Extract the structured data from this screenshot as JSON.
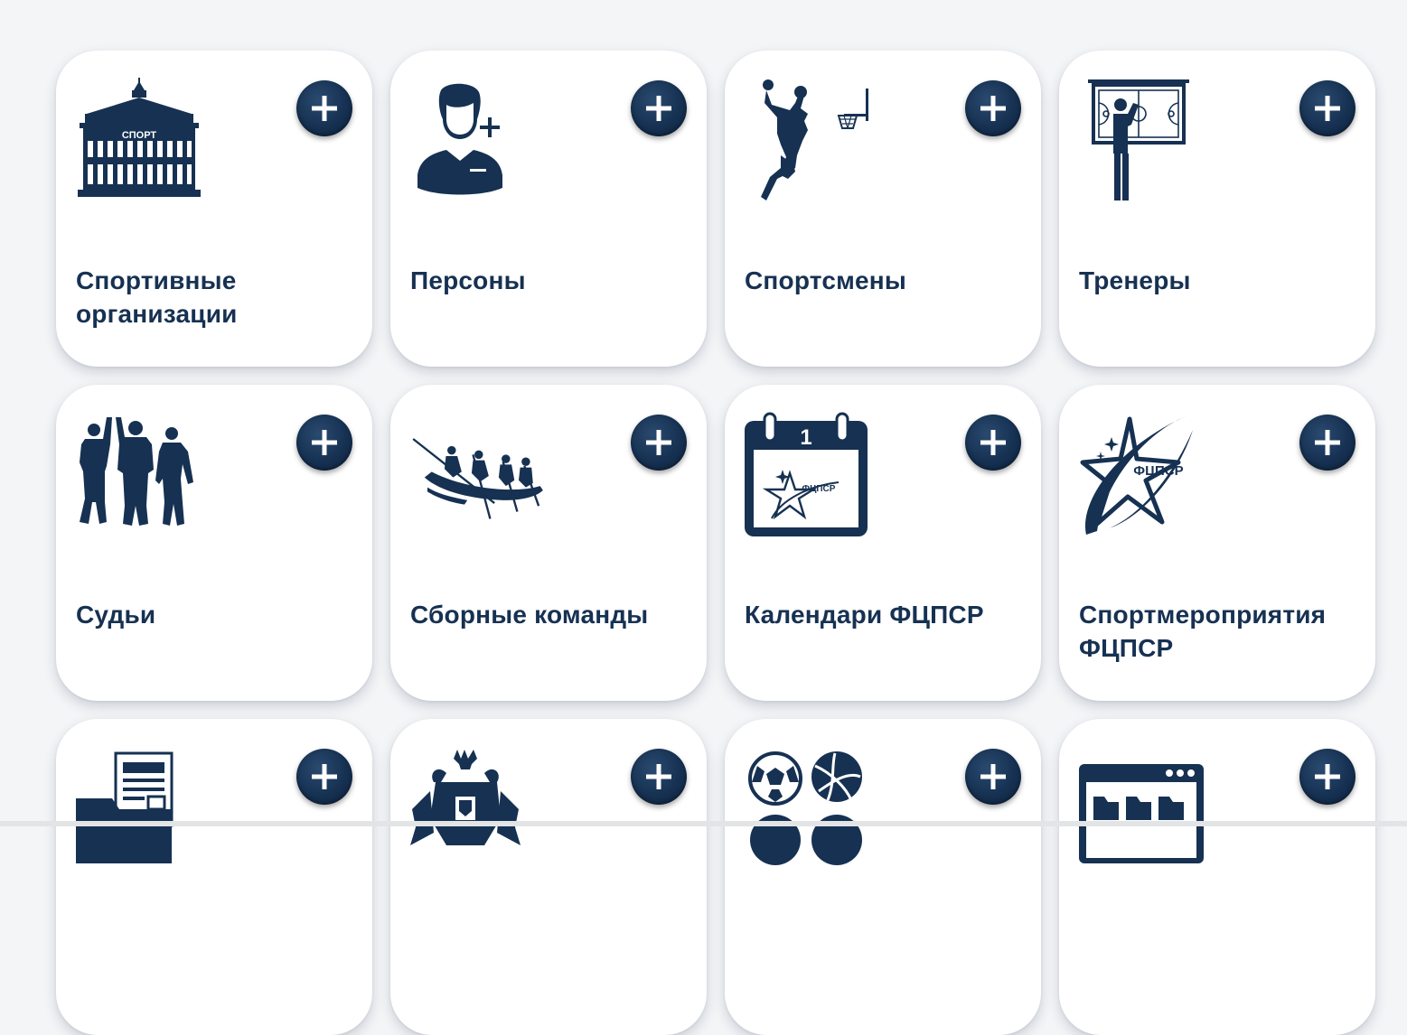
{
  "colors": {
    "primary": "#163152",
    "background": "#f4f5f7",
    "card": "#ffffff"
  },
  "cards": [
    {
      "title": "Спортивные организации",
      "icon": "sport-building-icon",
      "icon_text": "СПОРТ"
    },
    {
      "title": "Персоны",
      "icon": "person-add-icon"
    },
    {
      "title": "Спортсмены",
      "icon": "basketball-player-icon"
    },
    {
      "title": "Тренеры",
      "icon": "coach-board-icon"
    },
    {
      "title": "Судьи",
      "icon": "judges-icon"
    },
    {
      "title": "Сборные команды",
      "icon": "rafting-team-icon"
    },
    {
      "title": "Календари ФЦПСР",
      "icon": "calendar-icon",
      "icon_text": "ФЦПСР",
      "calendar_day": "1"
    },
    {
      "title": "Спортмероприятия ФЦПСР",
      "icon": "fcpsr-star-logo-icon",
      "icon_text": "ФЦПСР"
    },
    {
      "title": "",
      "icon": "documents-folder-icon"
    },
    {
      "title": "",
      "icon": "coat-of-arms-icon"
    },
    {
      "title": "",
      "icon": "balls-icon"
    },
    {
      "title": "",
      "icon": "browser-folders-icon"
    }
  ]
}
